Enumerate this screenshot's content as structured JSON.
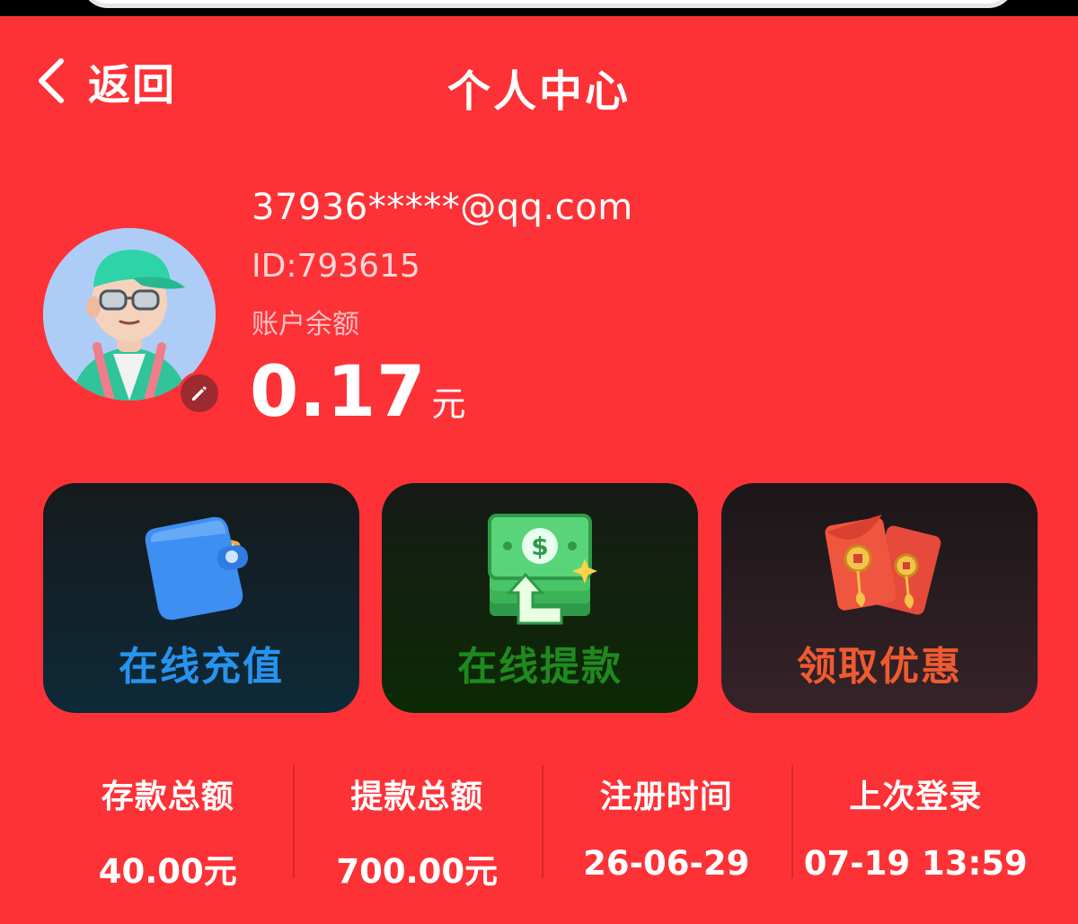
{
  "header": {
    "back_label": "返回",
    "title": "个人中心",
    "back_icon": "chevron-left-icon"
  },
  "profile": {
    "email": "37936*****@qq.com",
    "id_text": "ID:793615",
    "balance_label": "账户余额",
    "balance_amount": "0.17",
    "balance_unit": "元",
    "edit_icon": "pencil-icon"
  },
  "actions": [
    {
      "label": "在线充值",
      "icon": "wallet-icon",
      "color": "#2694ef"
    },
    {
      "label": "在线提款",
      "icon": "cash-withdraw-icon",
      "color": "#1e8a1e"
    },
    {
      "label": "领取优惠",
      "icon": "red-envelope-icon",
      "color": "#ee5a31"
    }
  ],
  "stats": [
    {
      "label": "存款总额",
      "value": "40.00元"
    },
    {
      "label": "提款总额",
      "value": "700.00元"
    },
    {
      "label": "注册时间",
      "value": "26-06-29"
    },
    {
      "label": "上次登录",
      "value": "07-19 13:59"
    }
  ],
  "colors": {
    "background": "#fd3237",
    "text": "#ffffff"
  }
}
